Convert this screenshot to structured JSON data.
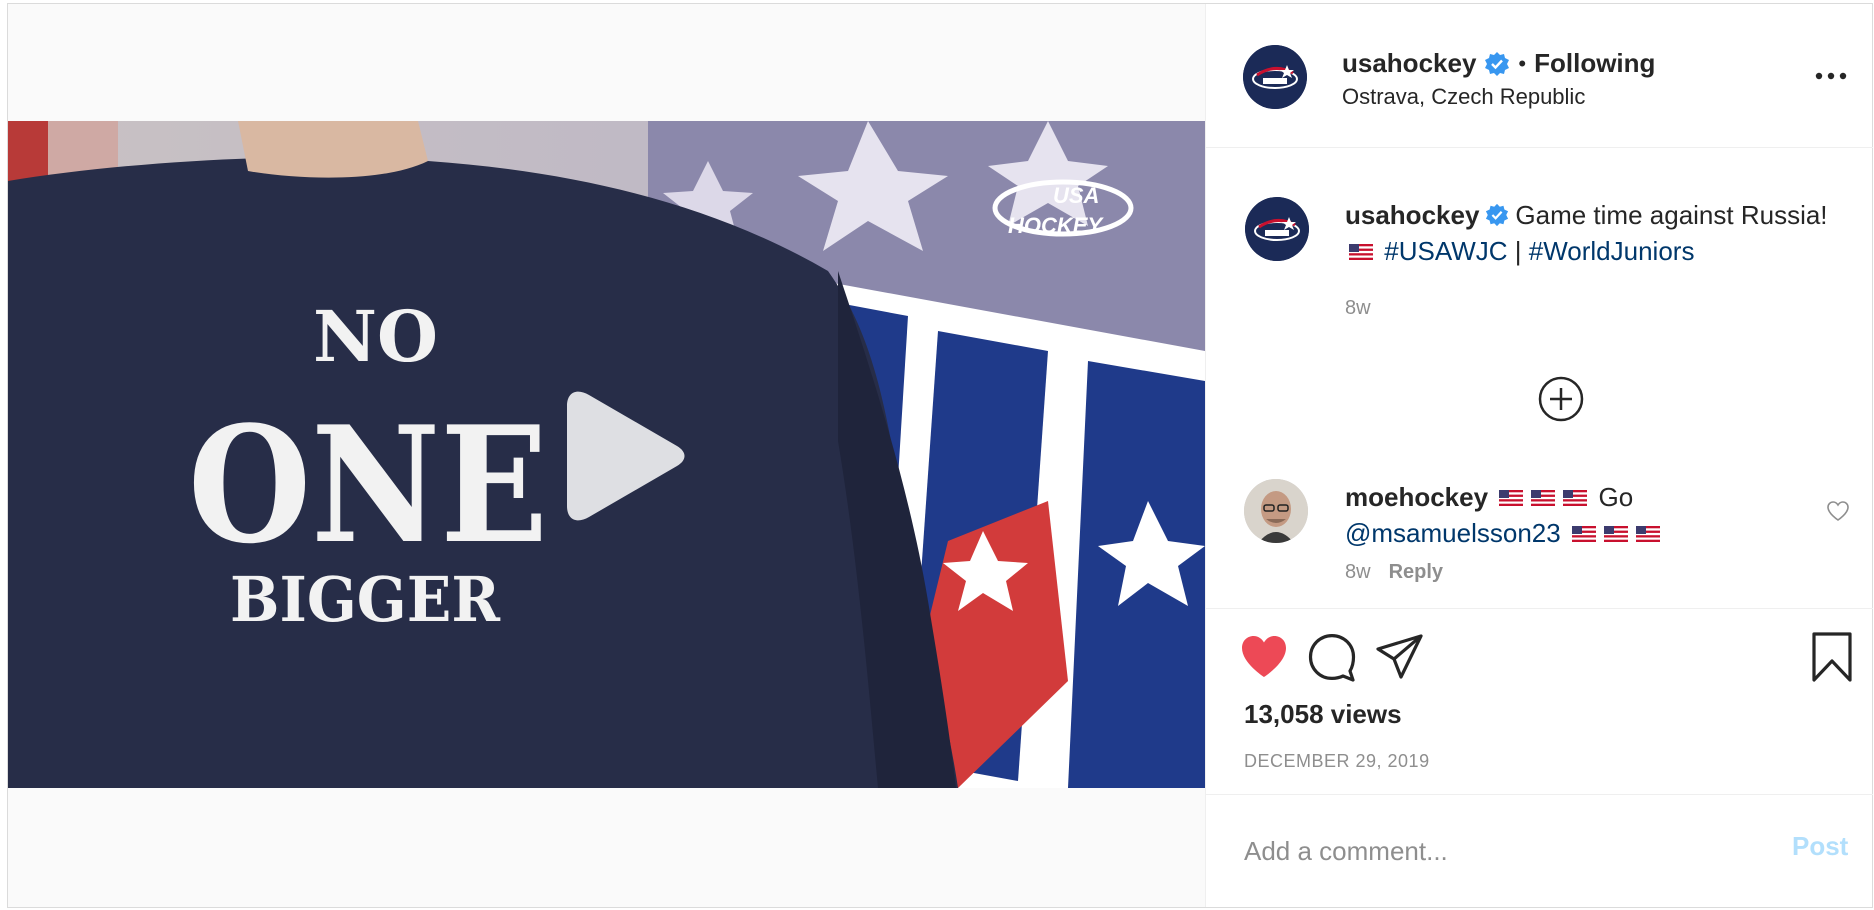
{
  "post": {
    "username": "usahockey",
    "follow_separator": "•",
    "follow_status": "Following",
    "location": "Ostrava, Czech Republic",
    "caption_text": "Game time against Russia!",
    "hashtag_1": "#USAWJC",
    "hashtag_separator": "|",
    "hashtag_2": "#WorldJuniors",
    "caption_time": "8w",
    "views": "13,058 views",
    "date": "DECEMBER 29, 2019"
  },
  "video": {
    "shirt_line1": "NO",
    "shirt_line2": "ONE",
    "shirt_line3": "BIGGER",
    "logo_line1": "USA",
    "logo_line2": "HOCKEY",
    "banner_letters": "USA"
  },
  "comments": [
    {
      "username": "moehockey",
      "text": "Go",
      "mention": "@msamuelsson23",
      "time": "8w",
      "reply_label": "Reply"
    }
  ],
  "comment_box": {
    "placeholder": "Add a comment...",
    "post_label": "Post"
  },
  "colors": {
    "like_red": "#ed4956",
    "verified_blue": "#3897f0",
    "link_blue": "#00376b",
    "post_disabled": "#b2dffc"
  }
}
